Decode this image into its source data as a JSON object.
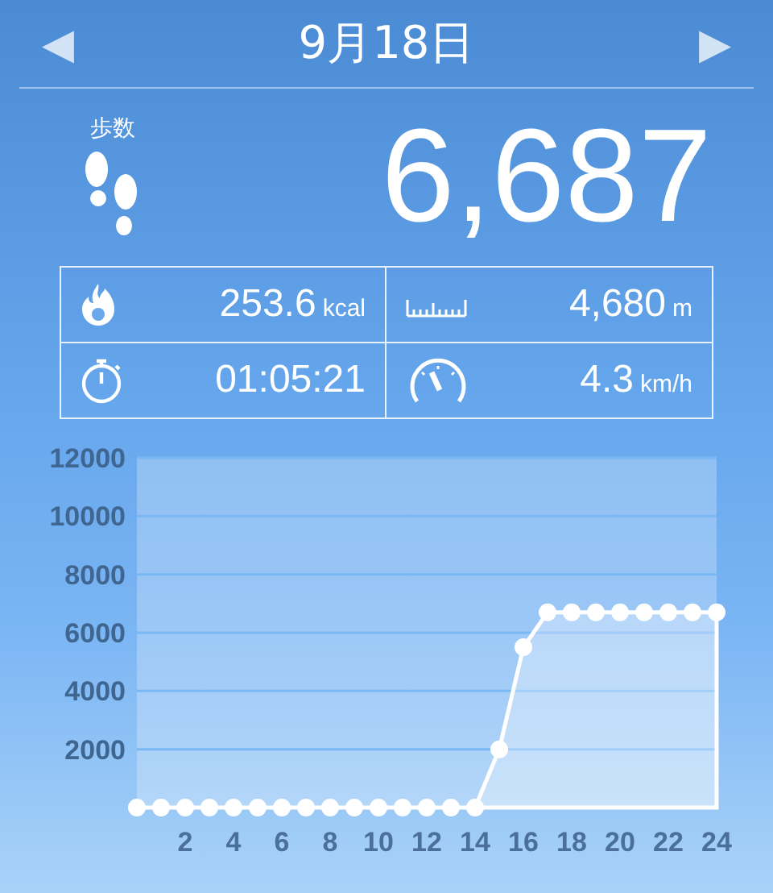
{
  "header": {
    "title": "9月18日",
    "prev": "◀",
    "next": "▶"
  },
  "steps": {
    "label": "歩数",
    "value": "6,687"
  },
  "stats": [
    {
      "kind": "calories",
      "value": "253.6",
      "unit": "kcal"
    },
    {
      "kind": "distance",
      "value": "4,680",
      "unit": "m"
    },
    {
      "kind": "time",
      "value": "01:05:21"
    },
    {
      "kind": "speed",
      "value": "4.3",
      "unit": "km/h"
    }
  ],
  "chart": {
    "chart_data": {
      "type": "area",
      "x": [
        0,
        1,
        2,
        3,
        4,
        5,
        6,
        7,
        8,
        9,
        10,
        11,
        12,
        13,
        14,
        15,
        16,
        17,
        18,
        19,
        20,
        21,
        22,
        23,
        24
      ],
      "series": [
        {
          "color": "#ffffff",
          "values": [
            0,
            0,
            0,
            0,
            0,
            0,
            0,
            0,
            0,
            0,
            0,
            0,
            0,
            0,
            0,
            2000,
            5500,
            6700,
            6700,
            6700,
            6700,
            6700,
            6700,
            6700,
            6700
          ]
        }
      ],
      "grid": true,
      "xlim": [
        0,
        24
      ],
      "ylim": [
        0,
        12000
      ],
      "xticks": [
        2,
        4,
        6,
        8,
        10,
        12,
        14,
        16,
        18,
        20,
        22,
        24
      ],
      "yticks": [
        2000,
        4000,
        6000,
        8000,
        10000,
        12000
      ]
    }
  }
}
